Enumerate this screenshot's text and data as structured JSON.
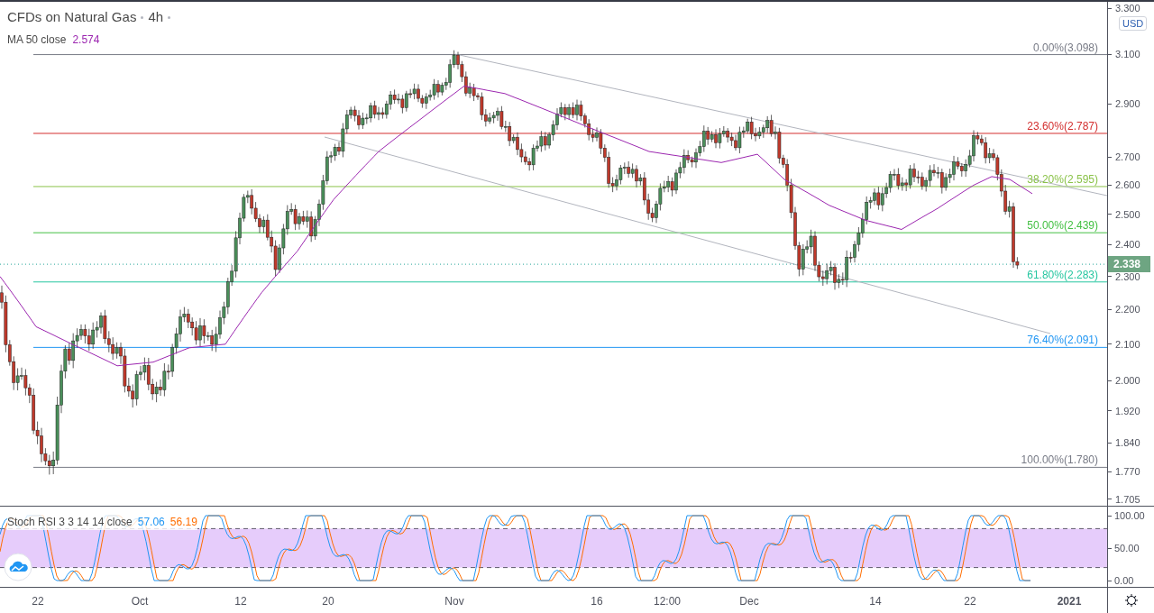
{
  "legend": {
    "symbol": "CFDs on Natural Gas",
    "interval": "4h",
    "ma_label": "MA 50 close",
    "ma_value": "2.574"
  },
  "price_axis": {
    "currency": "USD",
    "ticks": [
      "3.300",
      "3.100",
      "2.900",
      "2.700",
      "2.600",
      "2.500",
      "2.400",
      "2.300",
      "2.200",
      "2.100",
      "2.000",
      "1.920",
      "1.840",
      "1.770",
      "1.705"
    ],
    "last_price": "2.338"
  },
  "fib_levels": [
    {
      "label": "0.00%(3.098)",
      "color": "#787b86"
    },
    {
      "label": "23.60%(2.787)",
      "color": "#d32f2f"
    },
    {
      "label": "38.20%(2.595)",
      "color": "#8bc34a"
    },
    {
      "label": "50.00%(2.439)",
      "color": "#43c043"
    },
    {
      "label": "61.80%(2.283)",
      "color": "#26c6a0"
    },
    {
      "label": "76.40%(2.091)",
      "color": "#2196f3"
    },
    {
      "label": "100.00%(1.780)",
      "color": "#787b86"
    }
  ],
  "stoch_rsi": {
    "label": "Stoch RSI 3 3 14 14 close",
    "k_value": "57.06",
    "d_value": "56.19",
    "ticks": [
      "100.00",
      "50.00",
      "0.00"
    ]
  },
  "time_axis": [
    {
      "label": "22",
      "bold": false
    },
    {
      "label": "Oct",
      "bold": false
    },
    {
      "label": "12",
      "bold": false
    },
    {
      "label": "20",
      "bold": false
    },
    {
      "label": "Nov",
      "bold": false
    },
    {
      "label": "16",
      "bold": false
    },
    {
      "label": "12:00",
      "bold": false
    },
    {
      "label": "Dec",
      "bold": false
    },
    {
      "label": "14",
      "bold": false
    },
    {
      "label": "22",
      "bold": false
    },
    {
      "label": "2021",
      "bold": true
    }
  ]
}
